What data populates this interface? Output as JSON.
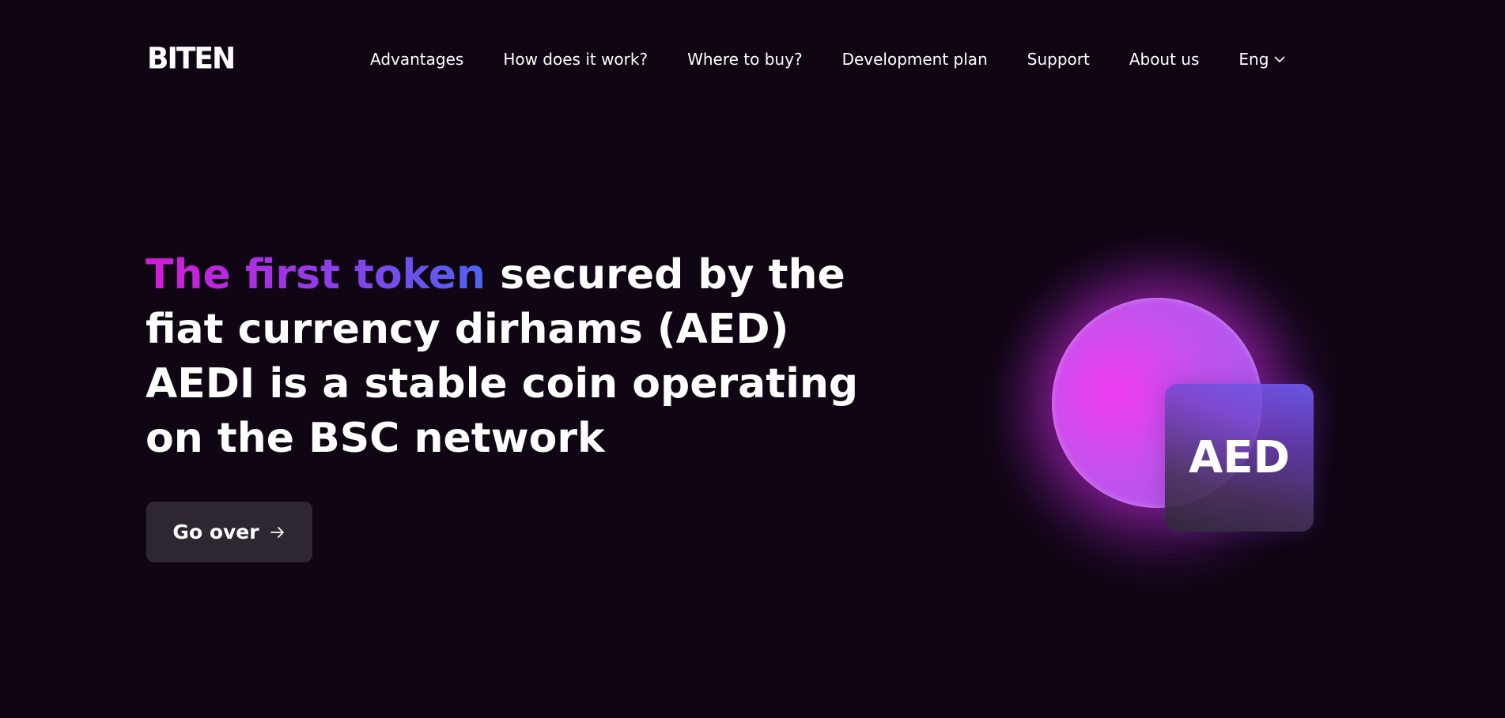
{
  "header": {
    "logo_text": "BITEN",
    "nav": [
      {
        "label": "Advantages"
      },
      {
        "label": "How does it work?"
      },
      {
        "label": "Where to buy?"
      },
      {
        "label": "Development plan"
      },
      {
        "label": "Support"
      },
      {
        "label": "About us"
      }
    ],
    "language": "Eng"
  },
  "hero": {
    "title_highlight": "The first token",
    "title_rest": " secured by the fiat currency dirhams (AED) AEDI is a stable coin operating on the BSC network",
    "button_label": "Go over",
    "card_label": "AED"
  },
  "colors": {
    "background": "#0f0513",
    "gradient_start": "#d61bd6",
    "gradient_end": "#4f63f0",
    "button_bg": "#2e2630"
  },
  "icons": {
    "language_dropdown": "chevron-down-icon",
    "button_arrow": "arrow-right-icon"
  }
}
